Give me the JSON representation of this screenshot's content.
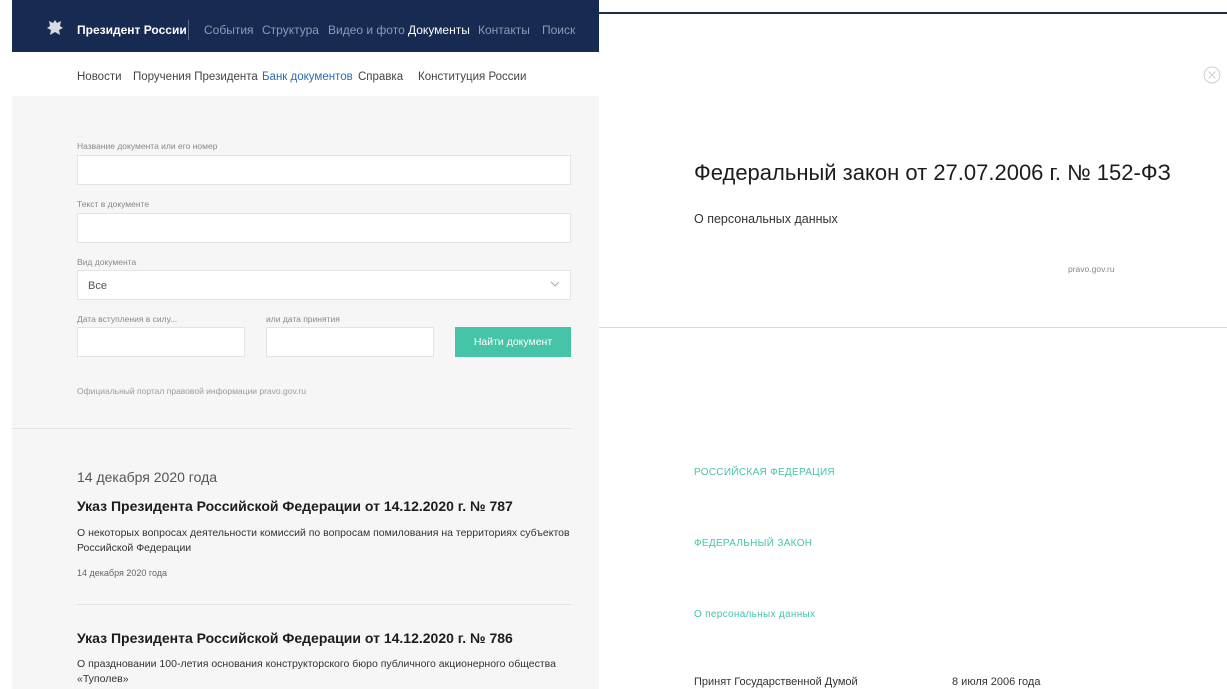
{
  "header": {
    "brand": "Президент России",
    "nav": [
      "События",
      "Структура",
      "Видео и фото",
      "Документы",
      "Контакты",
      "Поиск"
    ],
    "active_nav": "Документы"
  },
  "subnav": {
    "items": [
      "Новости",
      "Поручения Президента",
      "Банк документов",
      "Справка",
      "Конституция России"
    ],
    "active": "Банк документов"
  },
  "search_form": {
    "name_label": "Название документа или его номер",
    "name_value": "",
    "text_label": "Текст в документе",
    "text_value": "",
    "type_label": "Вид документа",
    "type_selected": "Все",
    "date_force_label": "Дата вступления в силу...",
    "date_adopted_label": "или дата принятия",
    "date_force_value": "",
    "date_adopted_value": "",
    "submit_label": "Найти документ",
    "portal_note": "Официальный портал правовой информации pravo.gov.ru"
  },
  "results": {
    "date_heading": "14 декабря 2020 года",
    "items": [
      {
        "title": "Указ Президента Российской Федерации от 14.12.2020 г. № 787",
        "description": "О некоторых вопросах деятельности комиссий по вопросам помилования на территориях субъектов Российской Федерации",
        "date": "14 декабря 2020 года"
      },
      {
        "title": "Указ Президента Российской Федерации от 14.12.2020 г. № 786",
        "description": "О праздновании 100-летия основания конструкторского бюро публичного акционерного общества «Туполев»",
        "date": ""
      }
    ]
  },
  "document": {
    "title": "Федеральный закон от 27.07.2006 г. № 152-ФЗ",
    "subtitle": "О персональных данных",
    "source": "pravo.gov.ru",
    "heading_country": "РОССИЙСКАЯ ФЕДЕРАЦИЯ",
    "heading_type": "ФЕДЕРАЛЬНЫЙ ЗАКОН",
    "heading_subject": "О персональных данных",
    "adopted_label": "Принят Государственной Думой",
    "adopted_date": "8 июля 2006 года"
  },
  "colors": {
    "header_bg": "#162a52",
    "accent_green": "#45c4a8",
    "link_blue": "#2a6cb3"
  }
}
